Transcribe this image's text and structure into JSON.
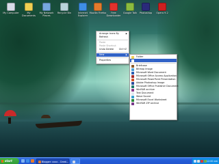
{
  "desktop_icons": [
    {
      "label": "My Computer",
      "icon": "computer-icon",
      "color": "#d7dde8"
    },
    {
      "label": "My Documents",
      "icon": "documents-folder-icon",
      "color": "#f1cf52"
    },
    {
      "label": "My Network\nPlaces",
      "icon": "network-icon",
      "color": "#76a7dd"
    },
    {
      "label": "Recycle Bin",
      "icon": "recycle-bin-icon",
      "color": "#b8d2da"
    },
    {
      "label": "Internet\nExplorer",
      "icon": "internet-explorer-icon",
      "color": "#3e8ee6"
    },
    {
      "label": "Mozilla Firefox",
      "icon": "firefox-icon",
      "color": "#e47a2c"
    },
    {
      "label": "Free\nDownloader",
      "icon": "downloader-icon",
      "color": "#e1312d"
    },
    {
      "label": "Google Talk",
      "icon": "google-talk-icon",
      "color": "#8bbb3e"
    },
    {
      "label": "Photoshop",
      "icon": "photoshop-icon",
      "color": "#2a2a7a"
    },
    {
      "label": "Opera 9.2",
      "icon": "opera-icon",
      "color": "#cc2020"
    }
  ],
  "context_menu": [
    {
      "label": "Arrange Icons By",
      "shortcut": "",
      "arrow": "▶",
      "state": "normal"
    },
    {
      "label": "Refresh",
      "shortcut": "",
      "arrow": "",
      "state": "normal"
    },
    {
      "sep": true
    },
    {
      "label": "Paste",
      "shortcut": "",
      "arrow": "",
      "state": "disabled"
    },
    {
      "label": "Paste Shortcut",
      "shortcut": "",
      "arrow": "",
      "state": "disabled"
    },
    {
      "label": "Undo Delete",
      "shortcut": "Ctrl+Z",
      "arrow": "",
      "state": "normal"
    },
    {
      "sep": true
    },
    {
      "label": "New",
      "shortcut": "",
      "arrow": "▶",
      "state": "highlight"
    },
    {
      "sep": true
    },
    {
      "label": "Properties",
      "shortcut": "",
      "arrow": "",
      "state": "normal"
    }
  ],
  "new_submenu": [
    {
      "label": "Folder",
      "icon": "folder-icon",
      "color": "#f1cf52",
      "state": "normal"
    },
    {
      "label": "",
      "icon": "shortcut-icon",
      "color": "#ffffff",
      "state": "highlight"
    },
    {
      "sep": true
    },
    {
      "label": "Briefcase",
      "icon": "briefcase-icon",
      "color": "#8a5a2a",
      "state": "normal"
    },
    {
      "label": "Bitmap Image",
      "icon": "bitmap-icon",
      "color": "#4aa0d8",
      "state": "normal"
    },
    {
      "label": "Microsoft Word Document",
      "icon": "word-document-icon",
      "color": "#2b5fb3",
      "state": "normal"
    },
    {
      "label": "Microsoft Office Access Application",
      "icon": "access-icon",
      "color": "#a42a2a",
      "state": "normal"
    },
    {
      "label": "Microsoft PowerPoint Presentation",
      "icon": "powerpoint-icon",
      "color": "#d2552a",
      "state": "normal"
    },
    {
      "label": "Adobe Photoshop Image",
      "icon": "photoshop-image-icon",
      "color": "#2a4a9a",
      "state": "normal"
    },
    {
      "label": "Microsoft Office Publisher Document",
      "icon": "publisher-icon",
      "color": "#1f7a6e",
      "state": "normal"
    },
    {
      "label": "WinRAR archive",
      "icon": "winrar-icon",
      "color": "#8b3a8b",
      "state": "normal"
    },
    {
      "label": "Text Document",
      "icon": "text-document-icon",
      "color": "#dfe6ee",
      "state": "normal"
    },
    {
      "label": "Wave Sound",
      "icon": "wave-sound-icon",
      "color": "#3aa0d0",
      "state": "normal"
    },
    {
      "label": "Microsoft Excel Worksheet",
      "icon": "excel-icon",
      "color": "#2a8a3a",
      "state": "normal"
    },
    {
      "label": "WinRAR ZIP archive",
      "icon": "zip-archive-icon",
      "color": "#7a3a8a",
      "state": "normal"
    }
  ],
  "taskbar": {
    "start_label": "start",
    "quick_launch": [
      {
        "icon": "show-desktop-icon",
        "color": "#7fb2f0"
      },
      {
        "icon": "internet-explorer-icon",
        "color": "#3e8ee6"
      },
      {
        "icon": "firefox-icon",
        "color": "#e47a2c"
      }
    ],
    "tasks": [
      {
        "label": "Blogger: xxxx - Creat...",
        "icon": "firefox-icon",
        "color": "#e47a2c",
        "active": true
      },
      {
        "label": "",
        "icon": "window-icon",
        "color": "#d0d8e8",
        "active": false
      }
    ],
    "tray_icons": [
      {
        "icon": "network-tray-icon",
        "color": "#c8e0f8"
      },
      {
        "icon": "volume-icon",
        "color": "#e0e0e0"
      },
      {
        "icon": "antivirus-icon",
        "color": "#d83a3a"
      },
      {
        "icon": "messenger-icon",
        "color": "#6ab04c"
      }
    ],
    "clock": "12:00 am"
  }
}
